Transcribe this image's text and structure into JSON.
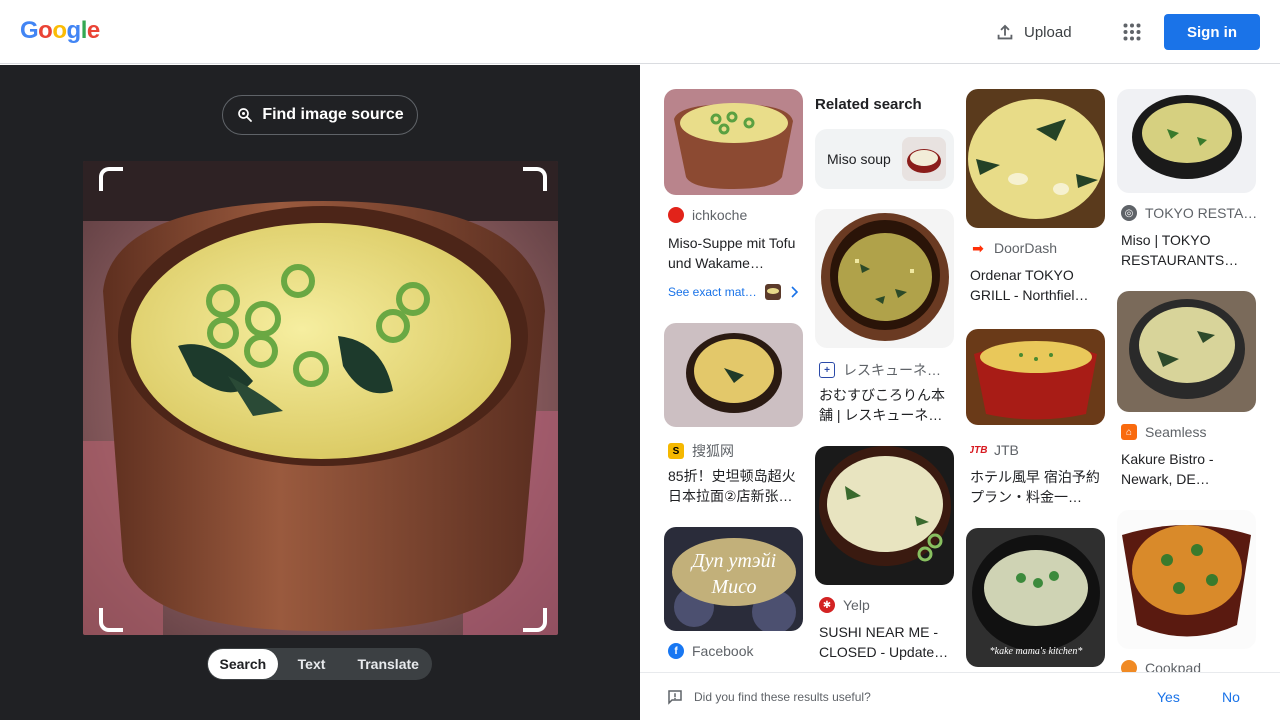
{
  "header": {
    "logo_letters": [
      "G",
      "o",
      "o",
      "g",
      "l",
      "e"
    ],
    "logo_colors": [
      "#4285f4",
      "#ea4335",
      "#fbbc05",
      "#4285f4",
      "#34a853",
      "#ea4335"
    ],
    "upload_label": "Upload",
    "signin_label": "Sign in",
    "accent_color": "#1a73e8"
  },
  "left": {
    "find_source_label": "Find image source",
    "tabs": [
      "Search",
      "Text",
      "Translate"
    ],
    "active_tab": "Search"
  },
  "related": {
    "title": "Related search",
    "chip_label": "Miso soup"
  },
  "results": [
    {
      "source": "ichkoche",
      "title": "Miso-Suppe mit Tofu und Wakame…",
      "icon": "ichkoche-icon"
    },
    {
      "source": "TOKYO RESTA…",
      "title": "Miso | TOKYO RESTAURANTS…",
      "icon": "globe-icon"
    },
    {
      "source": "DoorDash",
      "title": "Ordenar TOKYO GRILL - Northfiel…",
      "icon": "doordash-icon"
    },
    {
      "source": "レスキューネ…",
      "title": "おむすびころりん本舗 | レスキューネ…",
      "icon": "rescue-net-icon"
    },
    {
      "source": "搜狐网",
      "title": "85折！史坦顿岛超火日本拉面②店新张…",
      "icon": "sohu-icon"
    },
    {
      "source": "JTB",
      "title": "ホテル風早 宿泊予約プラン・料金一…",
      "icon": "jtb-icon"
    },
    {
      "source": "Seamless",
      "title": "Kakure Bistro - Newark, DE…",
      "icon": "seamless-icon"
    },
    {
      "source": "Yelp",
      "title": "SUSHI NEAR ME - CLOSED - Update…",
      "icon": "yelp-icon"
    },
    {
      "source": "Facebook",
      "title": "",
      "icon": "facebook-icon"
    },
    {
      "source": "Cookpad",
      "title": "",
      "icon": "cookpad-icon"
    }
  ],
  "exact_match_label": "See exact mat…",
  "image_text_overlays": {
    "facebook_thumb": [
      "Дуп утэйі",
      "Мисо"
    ],
    "kake_thumb": "*kake mama's kitchen*"
  },
  "feedback": {
    "question": "Did you find these results useful?",
    "yes": "Yes",
    "no": "No"
  }
}
